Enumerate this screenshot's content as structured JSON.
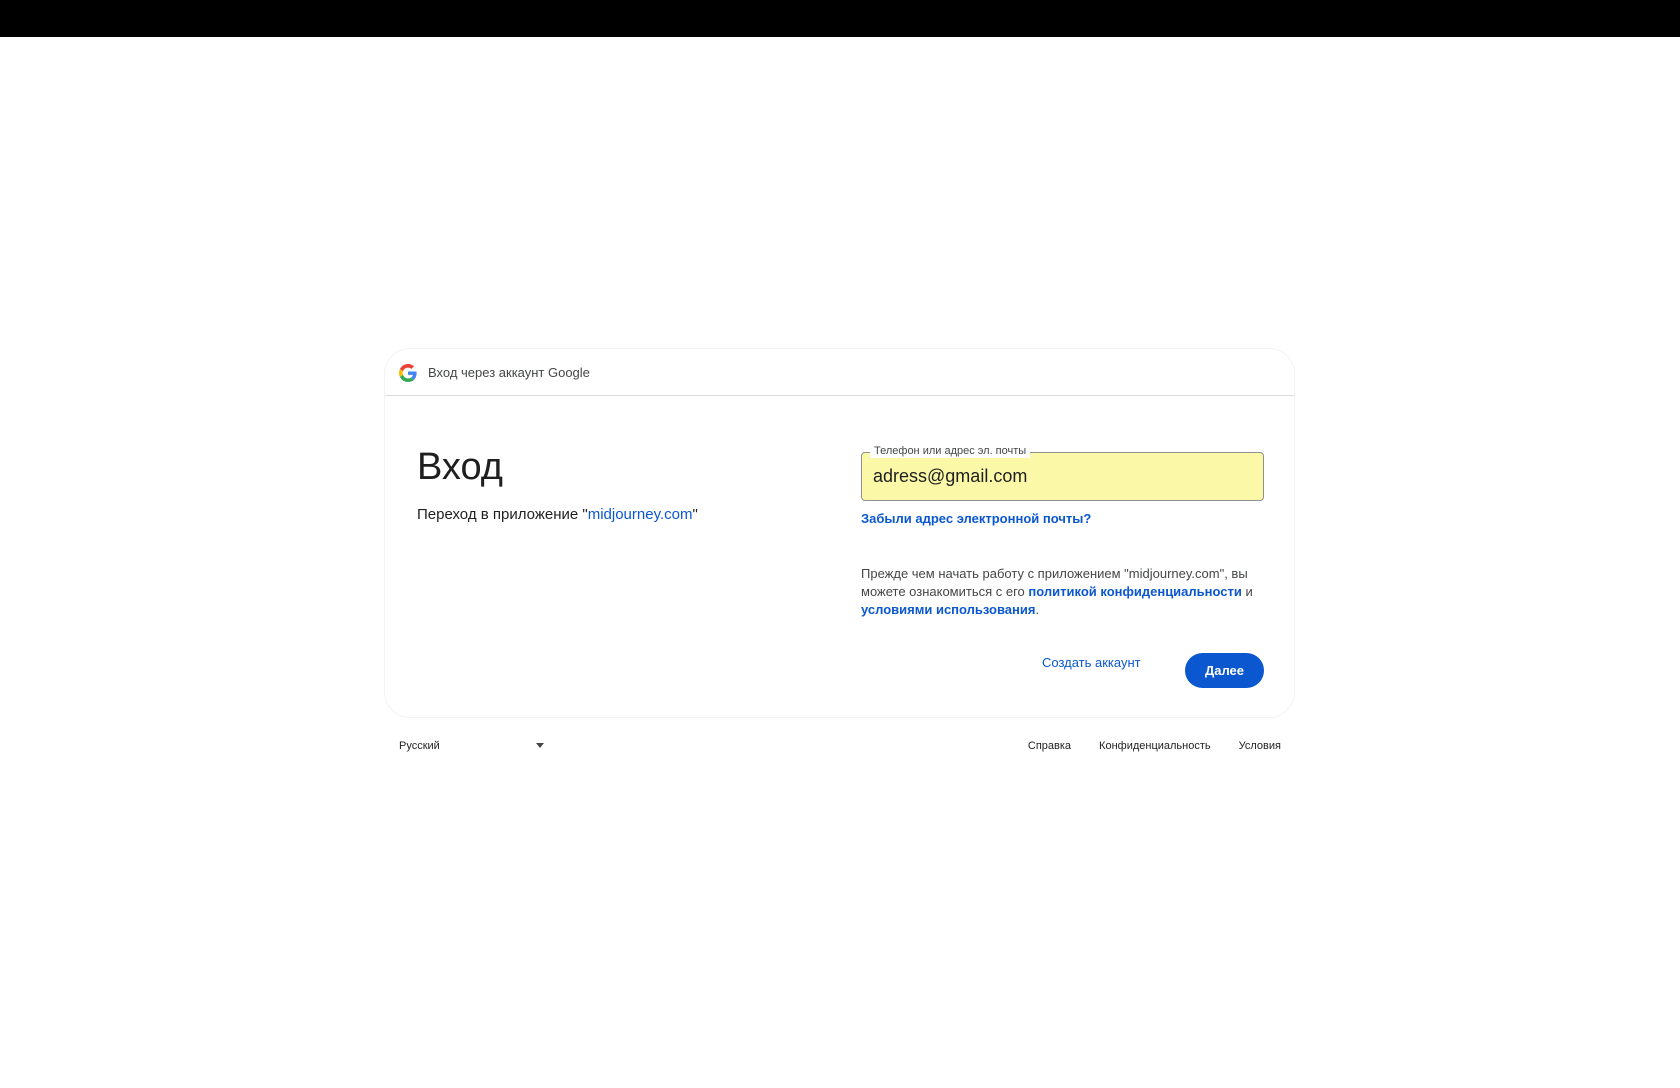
{
  "header": {
    "title": "Вход через аккаунт Google",
    "logo_icon": "google-g-icon"
  },
  "main": {
    "headline": "Вход",
    "subline_prefix": "Переход в приложение \"",
    "subline_app": "midjourney.com",
    "subline_suffix": "\""
  },
  "form": {
    "field_label": "Телефон или адрес эл. почты",
    "field_value": "adress@gmail.com",
    "forgot_link": "Забыли адрес электронной почты?"
  },
  "notice": {
    "text_before": "Прежде чем начать работу с приложением \"midjourney.com\", вы можете ознакомиться с его ",
    "privacy_link": "политикой конфиденциальности",
    "text_middle": " и ",
    "terms_link": "условиями использования",
    "text_after": "."
  },
  "actions": {
    "create_account": "Создать аккаунт",
    "next": "Далее"
  },
  "footer": {
    "language": "Русский",
    "links": [
      "Справка",
      "Конфиденциальность",
      "Условия"
    ]
  },
  "colors": {
    "accent": "#0b57d0",
    "autofill": "#fbf8a8"
  }
}
